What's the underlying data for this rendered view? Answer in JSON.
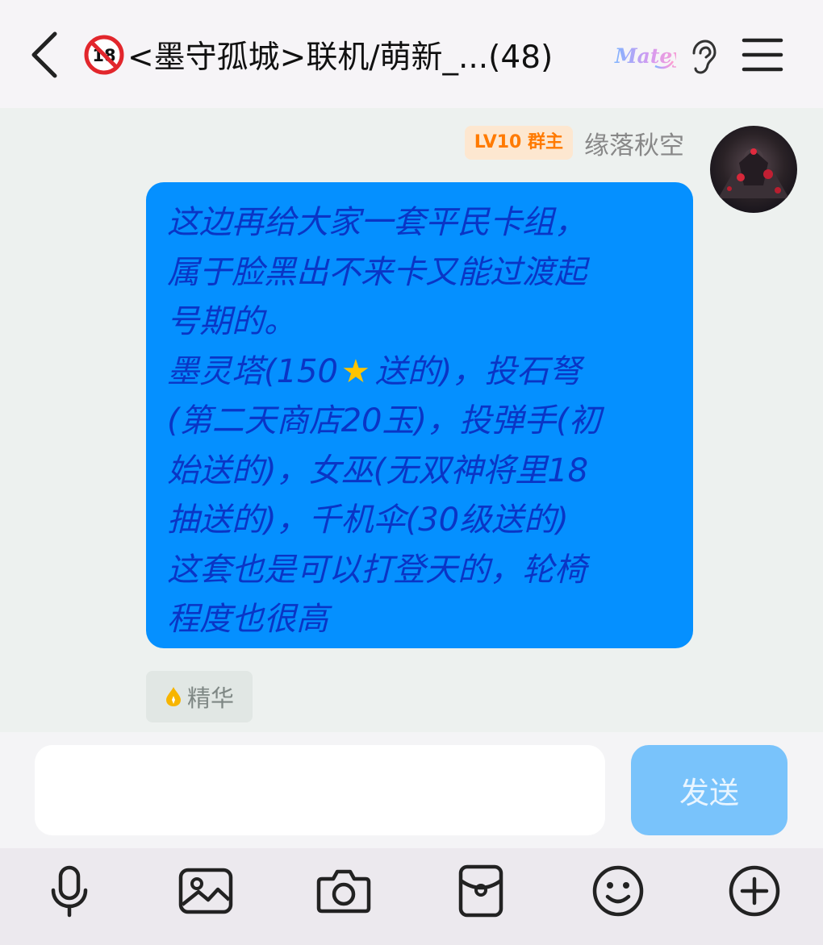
{
  "header": {
    "back_icon": "chevron-left-icon",
    "r18_badge_text": "18",
    "title": "<墨守孤城>联机/萌新_...(48)",
    "logo_text": "Matey",
    "ear_icon": "ear-icon",
    "menu_icon": "hamburger-menu-icon"
  },
  "message": {
    "level_badge": "LV10 群主",
    "sender_name": "缘落秋空",
    "lines": [
      "这边再给大家一套平民卡组，",
      "属于脸黑出不来卡又能过渡起",
      "号期的。",
      "墨灵塔(150",
      "送的)，投石弩",
      "(第二天商店20玉)，投弹手(初",
      "始送的)，女巫(无双神将里18",
      "抽送的)，千机伞(30级送的)",
      "这套也是可以打登天的，轮椅",
      "程度也很高"
    ],
    "star_icon": "star-icon",
    "essence_tag": "精华"
  },
  "input": {
    "value": "",
    "send_label": "发送"
  },
  "toolbar": {
    "items": [
      "microphone-icon",
      "image-icon",
      "camera-icon",
      "red-packet-icon",
      "emoji-icon",
      "plus-icon"
    ]
  },
  "colors": {
    "header_bg": "#f6f4f7",
    "chat_bg": "#edf1ef",
    "bubble_bg": "#0590ff",
    "bubble_text": "#0a35c5",
    "level_badge_bg": "#fde7d0",
    "level_badge_text": "#ff7a00",
    "send_button_bg": "#79c3fb",
    "toolbar_bg": "#ece9ee"
  }
}
